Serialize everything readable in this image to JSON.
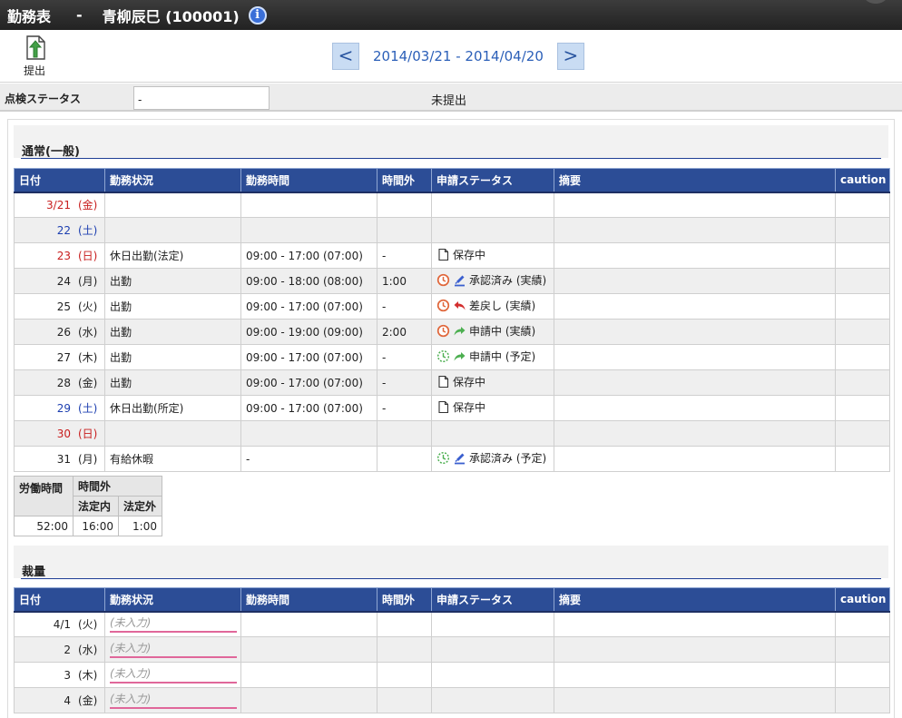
{
  "header": {
    "title": "勤務表",
    "separator": "-",
    "employee": "青柳辰巳 (100001)",
    "info_icon": "info-icon"
  },
  "toolbar": {
    "submit_label": "提出",
    "submit_icon": "submit-document-icon",
    "prev_label": "<",
    "next_label": ">",
    "period": "2014/03/21 - 2014/04/20"
  },
  "check_status": {
    "label": "点検ステータス",
    "input_value": "-",
    "value": "未提出"
  },
  "sections": [
    {
      "title": "通常(一般)",
      "columns": [
        "日付",
        "勤務状況",
        "勤務時間",
        "時間外",
        "申請ステータス",
        "摘要",
        "caution"
      ],
      "rows": [
        {
          "date": "3/21",
          "dow": "(金)",
          "date_color": "red",
          "status": "",
          "hours": "",
          "overtime": "",
          "app_icons": [],
          "app_status": "",
          "memo": "",
          "caution": ""
        },
        {
          "date": "22",
          "dow": "(土)",
          "date_color": "blue",
          "status": "",
          "hours": "",
          "overtime": "",
          "app_icons": [],
          "app_status": "",
          "memo": "",
          "caution": ""
        },
        {
          "date": "23",
          "dow": "(日)",
          "date_color": "red",
          "status": "休日出勤(法定)",
          "hours": "09:00 - 17:00 (07:00)",
          "overtime": "-",
          "app_icons": [
            "document-icon"
          ],
          "app_status": "保存中",
          "memo": "",
          "caution": ""
        },
        {
          "date": "24",
          "dow": "(月)",
          "date_color": "black",
          "status": "出勤",
          "hours": "09:00 - 18:00 (08:00)",
          "overtime": "1:00",
          "app_icons": [
            "clock-icon",
            "approved-stamp-icon"
          ],
          "app_status": "承認済み (実績)",
          "memo": "",
          "caution": ""
        },
        {
          "date": "25",
          "dow": "(火)",
          "date_color": "black",
          "status": "出勤",
          "hours": "09:00 - 17:00 (07:00)",
          "overtime": "-",
          "app_icons": [
            "clock-icon",
            "return-arrow-icon"
          ],
          "app_status": "差戻し (実績)",
          "memo": "",
          "caution": ""
        },
        {
          "date": "26",
          "dow": "(水)",
          "date_color": "black",
          "status": "出勤",
          "hours": "09:00 - 19:00 (09:00)",
          "overtime": "2:00",
          "app_icons": [
            "clock-icon",
            "forward-arrow-icon"
          ],
          "app_status": "申請中 (実績)",
          "memo": "",
          "caution": ""
        },
        {
          "date": "27",
          "dow": "(木)",
          "date_color": "black",
          "status": "出勤",
          "hours": "09:00 - 17:00 (07:00)",
          "overtime": "-",
          "app_icons": [
            "planned-clock-icon",
            "forward-arrow-icon"
          ],
          "app_status": "申請中 (予定)",
          "memo": "",
          "caution": ""
        },
        {
          "date": "28",
          "dow": "(金)",
          "date_color": "black",
          "status": "出勤",
          "hours": "09:00 - 17:00 (07:00)",
          "overtime": "-",
          "app_icons": [
            "document-icon"
          ],
          "app_status": "保存中",
          "memo": "",
          "caution": ""
        },
        {
          "date": "29",
          "dow": "(土)",
          "date_color": "blue",
          "status": "休日出勤(所定)",
          "hours": "09:00 - 17:00 (07:00)",
          "overtime": "-",
          "app_icons": [
            "document-icon"
          ],
          "app_status": "保存中",
          "memo": "",
          "caution": ""
        },
        {
          "date": "30",
          "dow": "(日)",
          "date_color": "red",
          "status": "",
          "hours": "",
          "overtime": "",
          "app_icons": [],
          "app_status": "",
          "memo": "",
          "caution": ""
        },
        {
          "date": "31",
          "dow": "(月)",
          "date_color": "black",
          "status": "有給休暇",
          "hours": "-",
          "overtime": "",
          "app_icons": [
            "planned-clock-icon",
            "approved-stamp-icon"
          ],
          "app_status": "承認済み (予定)",
          "memo": "",
          "caution": ""
        }
      ],
      "summary": {
        "headers": {
          "labor": "労働時間",
          "overtime": "時間外",
          "legal_in": "法定内",
          "legal_out": "法定外"
        },
        "values": {
          "labor": "52:00",
          "legal_in": "16:00",
          "legal_out": "1:00"
        }
      }
    },
    {
      "title": "裁量",
      "columns": [
        "日付",
        "勤務状況",
        "勤務時間",
        "時間外",
        "申請ステータス",
        "摘要",
        "caution"
      ],
      "rows": [
        {
          "date": "4/1",
          "dow": "(火)",
          "date_color": "black",
          "placeholder": "(未入力)"
        },
        {
          "date": "2",
          "dow": "(水)",
          "date_color": "black",
          "placeholder": "(未入力)"
        },
        {
          "date": "3",
          "dow": "(木)",
          "date_color": "black",
          "placeholder": "(未入力)"
        },
        {
          "date": "4",
          "dow": "(金)",
          "date_color": "black",
          "placeholder": "(未入力)"
        }
      ]
    }
  ],
  "colors": {
    "header_bar": "#2c4d96",
    "sunday_red": "#c81e1e",
    "saturday_blue": "#1d3fb0",
    "nav_accent": "#2b5fb8"
  }
}
